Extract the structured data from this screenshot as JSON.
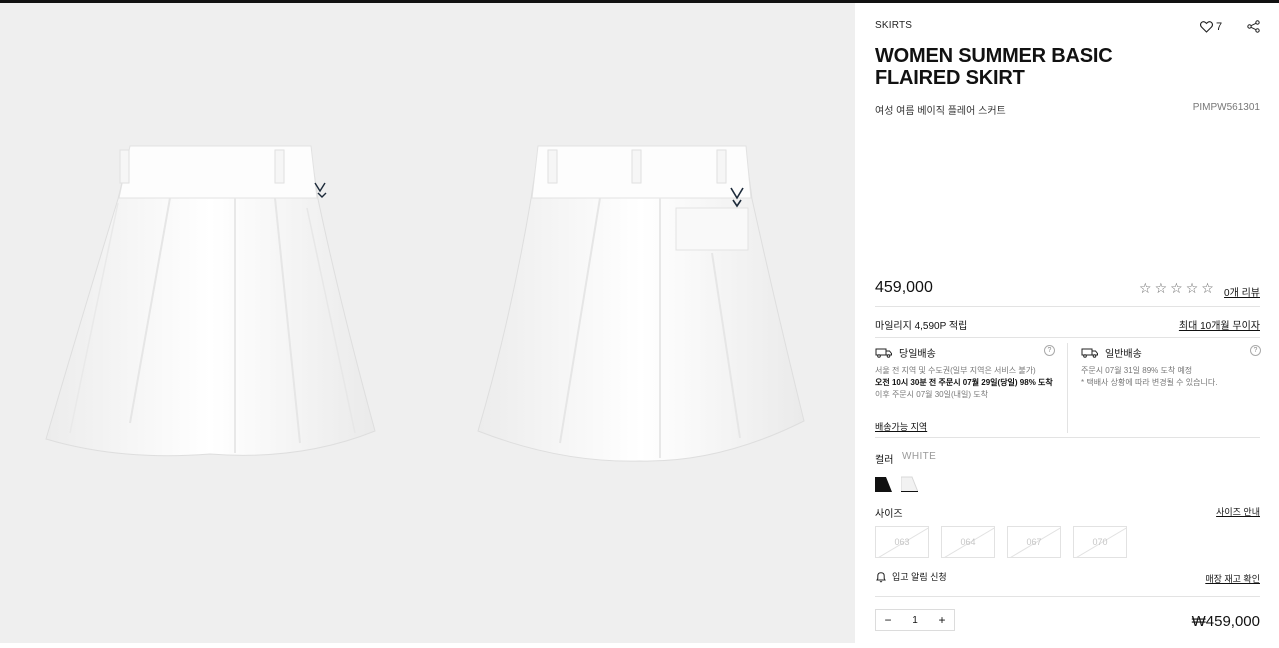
{
  "product": {
    "category": "SKIRTS",
    "title": "WOMEN SUMMER BASIC FLAIRED SKIRT",
    "subtitle": "여성 여름 베이직 플레어 스커트",
    "code": "PIMPW561301",
    "wishlist_count": "7",
    "price": "459,000",
    "rating": 0,
    "review_link": "0개 리뷰",
    "mileage": "마일리지 4,590P 적립",
    "installment_link": "최대 10개월 무이자"
  },
  "delivery": {
    "same_day": {
      "title": "당일배송",
      "line1": "서울 전 지역 및 수도권(일부 지역은 서비스 불가)",
      "line2": "오전 10시 30분 전 주문시 07월 29일(당일) 98% 도착",
      "line3": "이후 주문시 07월 30일(내일) 도착"
    },
    "standard": {
      "title": "일반배송",
      "line1": "주문시 07월 31일 89% 도착 예정",
      "line2": "* 택배사 상황에 따라 변경될 수 있습니다."
    },
    "region_link": "배송가능 지역"
  },
  "color": {
    "label": "컬러",
    "selected": "WHITE",
    "swatches": [
      "#111111",
      "#f2f2f2"
    ]
  },
  "size": {
    "label": "사이즈",
    "guide_link": "사이즈 안내",
    "options": [
      "063",
      "064",
      "067",
      "070"
    ]
  },
  "restock_label": "입고 알림 신청",
  "store_stock_link": "매장 재고 확인",
  "order": {
    "quantity": "1",
    "total": "₩459,000"
  },
  "colors": {
    "gallery_bg": "#efefef",
    "skirt": "#fbfbfb",
    "logo": "#1c2a3a"
  }
}
